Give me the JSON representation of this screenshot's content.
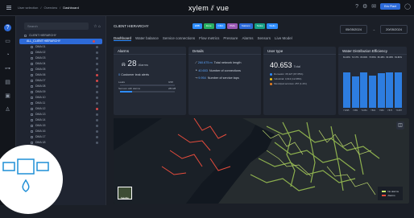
{
  "topbar": {
    "breadcrumb": [
      "User selection",
      "/",
      "Overview",
      "/",
      "Dashboard"
    ],
    "logo": "xylem ⫽ vue",
    "icons": [
      "help-icon",
      "settings-icon",
      "mail-icon"
    ],
    "user_label": "Eric Plant"
  },
  "rail": {
    "icons": [
      "home-icon",
      "camera-icon",
      "gauge-icon",
      "pipe-icon",
      "chart-icon",
      "device-icon",
      "user-icon"
    ]
  },
  "tree": {
    "search_placeholder": "Search",
    "root": "CLIENT HIERARCHY",
    "selected": "ALL_CLIENT HIERARCHY",
    "items": [
      "DMA 01",
      "DMA 02",
      "DMA 03",
      "DMA 04",
      "DMA 05",
      "DMA 06",
      "DMA 07",
      "DMA 08",
      "DMA 09",
      "DMA 10",
      "DMA 11",
      "DMA 12",
      "DMA 13",
      "DMA 14",
      "DMA 15",
      "DMA 16",
      "DMA 17",
      "DMA 18"
    ],
    "alarm_items": [
      5,
      6,
      11
    ]
  },
  "header": {
    "title": "CLIENT HIERARCHY",
    "chips": [
      {
        "label": "EBB",
        "color": "#2d8cff"
      },
      {
        "label": "Zone",
        "color": "#27ae60"
      },
      {
        "label": "DMA",
        "color": "#2d8cff"
      },
      {
        "label": "PMA",
        "color": "#9b59b6"
      },
      {
        "label": "Stations",
        "color": "#2d6ad8"
      },
      {
        "label": "Tanks",
        "color": "#16a085"
      },
      {
        "label": "Wells",
        "color": "#2d8cff"
      }
    ],
    "date_from": "05/05/2024",
    "arrow": "→",
    "date_to": "20/05/2024"
  },
  "tabs": [
    "Dashboard",
    "Water balance",
    "Service connections",
    "Flow metrics",
    "Pressure",
    "Alarms",
    "Sensors",
    "Live Model"
  ],
  "alarms": {
    "title": "Alarms",
    "count": "28",
    "count_label": "Alarms",
    "leak_count": "0",
    "leak_label": "Customer leak alerts",
    "leaks_label": "Leaks",
    "leaks_value": "0/28",
    "leaks_fraction": 0,
    "sensors_label": "Sensors with alarms",
    "sensors_value": "28/128",
    "sensors_fraction": 0.22
  },
  "details": {
    "title": "Details",
    "rows": [
      {
        "value": "260.675 m",
        "label": "Total network length"
      },
      {
        "value": "40.653",
        "label": "Number of connections"
      },
      {
        "value": "9.954",
        "label": "Number of service taps"
      }
    ]
  },
  "usertype": {
    "title": "User type",
    "total": "40.653",
    "total_label": "Total",
    "items": [
      {
        "label": "Domestic: 35,327 (87.05%)",
        "color": "#2d8cff"
      },
      {
        "label": "Industrial: 4,913 (12.08%)",
        "color": "#f1c40f"
      },
      {
        "label": "Municipal services: 257 (1.2%)",
        "color": "#e67e22"
      }
    ]
  },
  "efficiency": {
    "title": "Water Distribution Efficiency",
    "percents": [
      "81.29%",
      "72.17%",
      "80.93%",
      "73.56%",
      "80.48%",
      "82.38%",
      "81.82%"
    ],
    "values": [
      81.29,
      72.17,
      80.93,
      73.56,
      80.48,
      82.38,
      81.82
    ],
    "x_labels": [
      "Y1095",
      "Y489",
      "Y1081",
      "Y801",
      "Y950",
      "Y876",
      "Y1087"
    ]
  },
  "map": {
    "legend": [
      "No alarms",
      "Alarms"
    ],
    "legend_colors": [
      "#c9e96a",
      "#e74c3c"
    ],
    "satellite_label": "Satellite",
    "layers_icon": "layers-icon"
  }
}
